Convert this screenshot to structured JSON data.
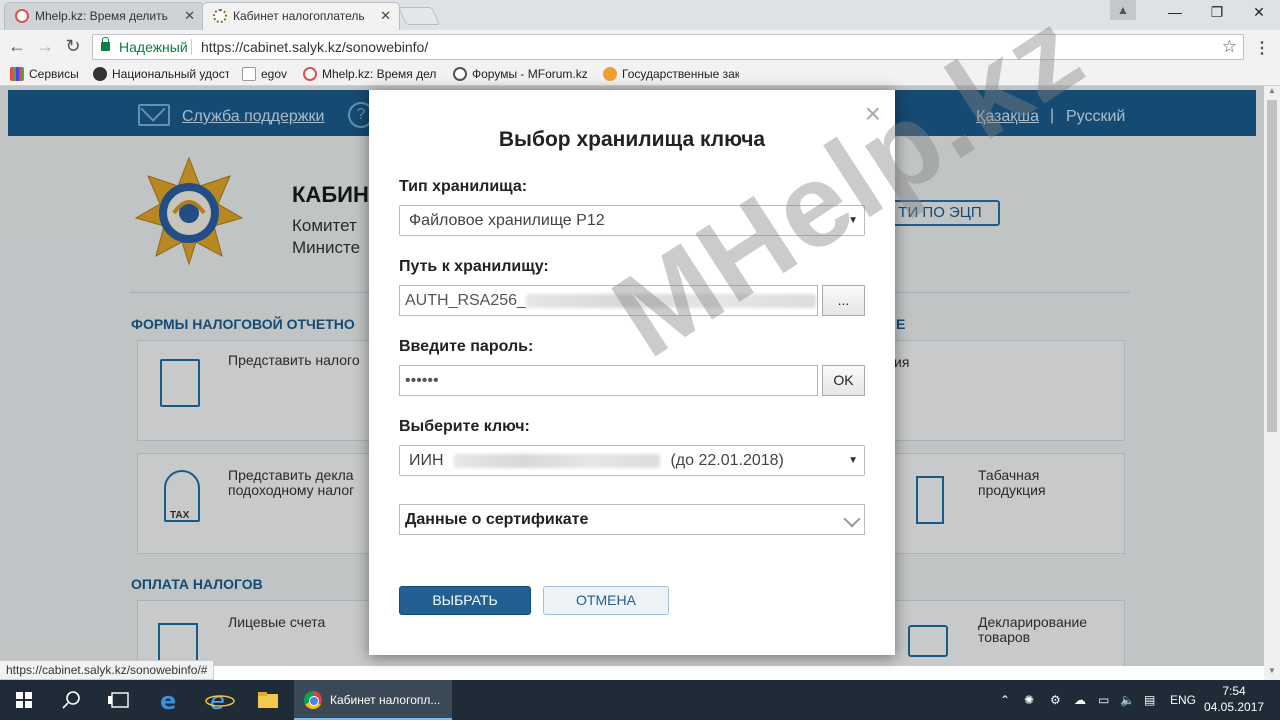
{
  "browser": {
    "tabs": [
      {
        "title": "Mhelp.kz: Время делить",
        "active": false
      },
      {
        "title": "Кабинет налогоплатель",
        "active": true
      }
    ],
    "secure_label": "Надежный",
    "url": "https://cabinet.salyk.kz/sonowebinfo/",
    "bookmarks": [
      {
        "label": "Сервисы",
        "icon": "apps-grid-icon"
      },
      {
        "label": "Национальный удост",
        "icon": "globe-icon"
      },
      {
        "label": "egov",
        "icon": "egov-icon"
      },
      {
        "label": "Mhelp.kz: Время дел",
        "icon": "mhelp-icon"
      },
      {
        "label": "Форумы - MForum.kz",
        "icon": "forum-icon"
      },
      {
        "label": "Государственные зак",
        "icon": "gov-icon"
      }
    ],
    "status_url": "https://cabinet.salyk.kz/sonowebinfo/#"
  },
  "page": {
    "support_link": "Служба поддержки",
    "help_symbol": "?",
    "lang_kk": "Қазақша",
    "lang_separator": "|",
    "lang_ru": "Русский",
    "title": "КАБИН",
    "subtitle1": "Комитет",
    "subtitle2": "Министе",
    "ecp_button": "ТИ ПО ЭЦП",
    "section_forms": "ФОРМЫ НАЛОГОВОЙ ОТЧЕТНО",
    "section_forms_right": "Е",
    "card1": "Представить налого",
    "card1_right": "ия",
    "card2_line1": "Представить декла",
    "card2_line2": "подоходному налог",
    "tax_label": "TAX",
    "card3_line1": "Табачная",
    "card3_line2": "продукция",
    "section_payment": "ОПЛАТА НАЛОГОВ",
    "card4": "Лицевые счета",
    "card5_line1": "Декларирование",
    "card5_line2": "товаров"
  },
  "modal": {
    "title": "Выбор хранилища ключа",
    "close_symbol": "×",
    "storage_type_label": "Тип хранилища:",
    "storage_type_value": "Файловое хранилище P12",
    "storage_path_label": "Путь к хранилищу:",
    "storage_path_value": "AUTH_RSA256_",
    "browse_label": "...",
    "password_label": "Введите пароль:",
    "password_value": "••••••",
    "ok_label": "OK",
    "key_label": "Выберите ключ:",
    "key_prefix": "ИИН",
    "key_suffix": "(до 22.01.2018)",
    "cert_label": "Данные о сертификате",
    "select_button": "ВЫБРАТЬ",
    "cancel_button": "ОТМЕНА"
  },
  "watermark": "MHelp.kz",
  "taskbar": {
    "app_label": "Кабинет налогопл...",
    "lang": "ENG",
    "time": "7:54",
    "date": "04.05.2017"
  },
  "colors": {
    "header_blue": "#1a5b8c",
    "primary_button": "#215f95",
    "secure_green": "#0b8043"
  }
}
